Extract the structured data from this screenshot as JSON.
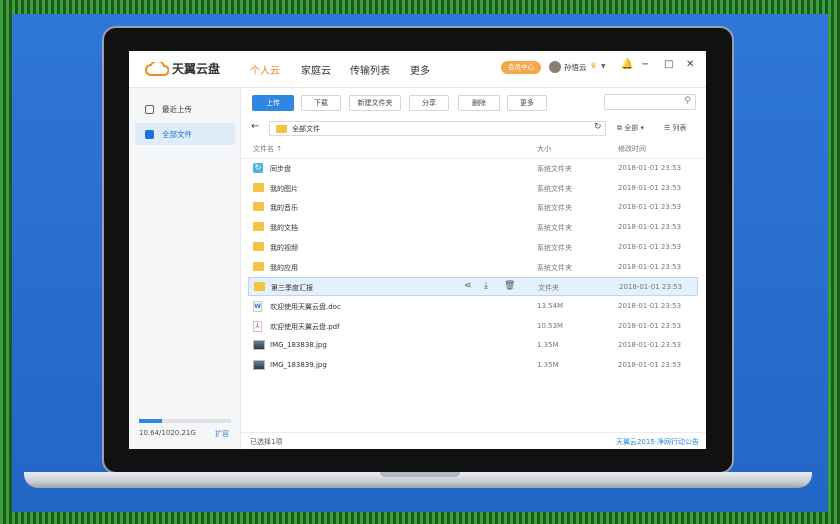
{
  "app": {
    "logo_text": "天翼云盘",
    "nav": [
      {
        "label": "个人云",
        "active": true
      },
      {
        "label": "家庭云",
        "active": false
      },
      {
        "label": "传输列表",
        "active": false
      },
      {
        "label": "更多",
        "active": false
      }
    ],
    "member_label": "会员中心",
    "username": "孙悟云",
    "accent_color": "#2f86e3",
    "active_nav_color": "#f08c1c"
  },
  "sidebar": {
    "items": [
      {
        "label": "最近上传",
        "icon": "recent-upload-icon",
        "active": false
      },
      {
        "label": "全部文件",
        "icon": "all-files-icon",
        "active": true
      }
    ],
    "storage_text": "10.64/1020.21G",
    "storage_fraction": 0.25,
    "expand_label": "扩容"
  },
  "toolbar": {
    "buttons": [
      "上传",
      "下载",
      "新建文件夹",
      "分享",
      "删除",
      "更多"
    ],
    "search_placeholder": ""
  },
  "pathbar": {
    "path": "全部文件",
    "copy_label": "全部",
    "view_label": "列表"
  },
  "table": {
    "columns": [
      "文件名",
      "大小",
      "修改时间"
    ],
    "rows": [
      {
        "name": "同步盘",
        "type": "sync",
        "size": "系统文件夹",
        "date": "2018-01-01 23:53"
      },
      {
        "name": "我的图片",
        "type": "folder",
        "size": "系统文件夹",
        "date": "2018-01-01 23:53"
      },
      {
        "name": "我的音乐",
        "type": "folder",
        "size": "系统文件夹",
        "date": "2018-01-01 23:53"
      },
      {
        "name": "我的文档",
        "type": "folder",
        "size": "系统文件夹",
        "date": "2018-01-01 23:53"
      },
      {
        "name": "我的视频",
        "type": "folder",
        "size": "系统文件夹",
        "date": "2018-01-01 23:53"
      },
      {
        "name": "我的应用",
        "type": "folder",
        "size": "系统文件夹",
        "date": "2018-01-01 23:53"
      },
      {
        "name": "第三季度汇报",
        "type": "folder",
        "size": "文件夹",
        "date": "2018-01-01 23:53",
        "selected": true
      },
      {
        "name": "欢迎使用天翼云盘.doc",
        "type": "doc",
        "size": "13.54M",
        "date": "2018-01-01 23:53"
      },
      {
        "name": "欢迎使用天翼云盘.pdf",
        "type": "pdf",
        "size": "10.53M",
        "date": "2018-01-01 23:53"
      },
      {
        "name": "IMG_183838.jpg",
        "type": "img",
        "size": "1.35M",
        "date": "2018-01-01 23:53"
      },
      {
        "name": "IMG_183839.jpg",
        "type": "img",
        "size": "1.35M",
        "date": "2018-01-01 23:53"
      }
    ]
  },
  "footer": {
    "selected_text": "已选择1项",
    "notice": "天翼云2015·净网行动公告"
  }
}
